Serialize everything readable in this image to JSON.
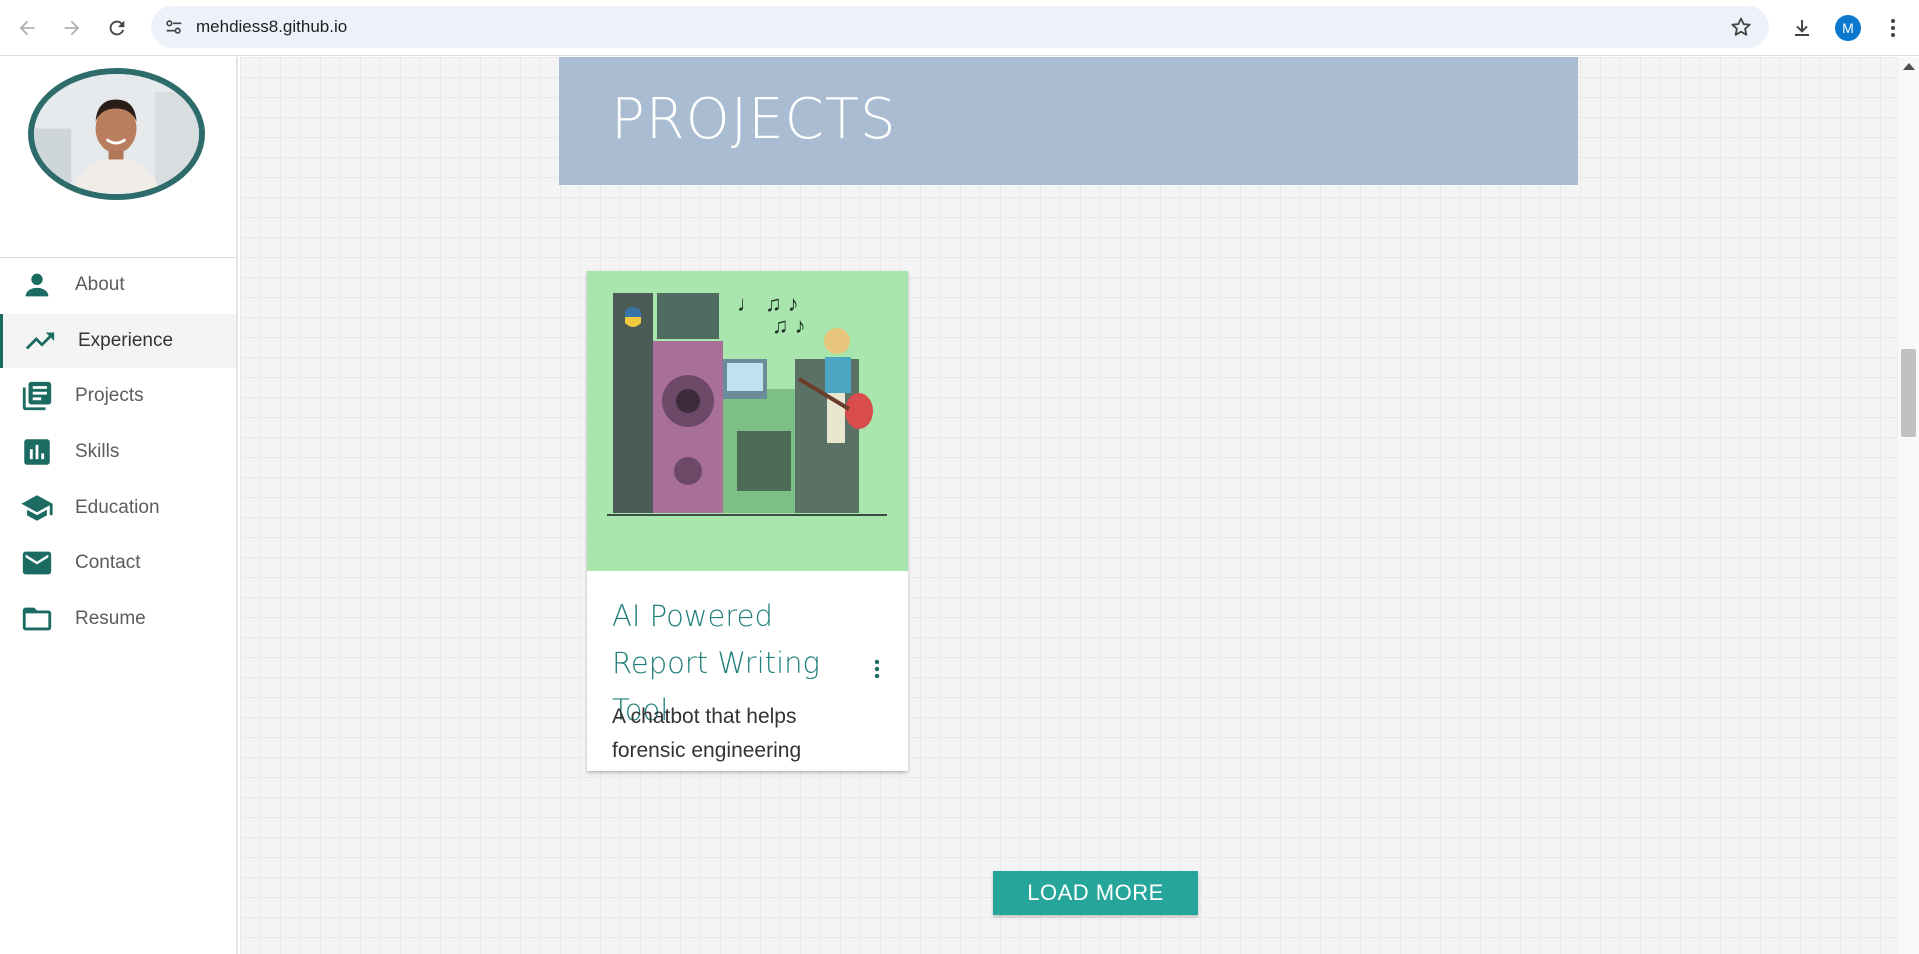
{
  "browser": {
    "url": "mehdiess8.github.io",
    "profile_initial": "M",
    "icons": [
      "back-icon",
      "forward-icon",
      "reload-icon",
      "site-settings-icon",
      "bookmark-star-icon",
      "download-icon",
      "menu-kebab-icon"
    ]
  },
  "sidebar": {
    "items": [
      {
        "label": "About",
        "icon": "person-icon"
      },
      {
        "label": "Experience",
        "icon": "trending-up-icon",
        "active": true
      },
      {
        "label": "Projects",
        "icon": "library-books-icon"
      },
      {
        "label": "Skills",
        "icon": "bar-chart-icon"
      },
      {
        "label": "Education",
        "icon": "school-icon"
      },
      {
        "label": "Contact",
        "icon": "mail-icon"
      },
      {
        "label": "Resume",
        "icon": "folder-icon"
      }
    ]
  },
  "main": {
    "section_title": "PROJECTS",
    "card": {
      "title": "AI Powered Report Writing Tool",
      "description": "A chatbot that helps forensic engineering"
    },
    "load_more_label": "LOAD MORE"
  },
  "colors": {
    "accent": "#1c6b63",
    "button": "#26a69a",
    "header_bg": "#a9bcd2",
    "card_image_bg": "#a8e6ae"
  }
}
